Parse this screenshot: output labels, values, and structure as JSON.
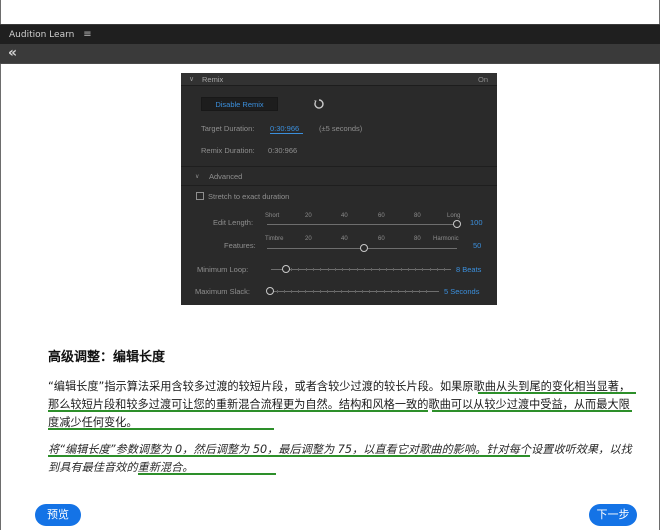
{
  "app": {
    "title": "Audition Learn",
    "menu_glyph": "≡",
    "back_glyph": "«"
  },
  "remix": {
    "header": "Remix",
    "header_state": "On",
    "disable_button": "Disable Remix",
    "target_duration_label": "Target Duration:",
    "target_duration_value": "0:30:966",
    "target_duration_tolerance": "(±5 seconds)",
    "remix_duration_label": "Remix Duration:",
    "remix_duration_value": "0:30:966",
    "advanced_label": "Advanced",
    "stretch_label": "Stretch to exact duration",
    "edit_length": {
      "label": "Edit Length:",
      "left": "Short",
      "right": "Long",
      "ticks": [
        "20",
        "40",
        "60",
        "80"
      ],
      "value": "100",
      "level": 100
    },
    "features": {
      "label": "Features:",
      "left": "Timbre",
      "right": "Harmonic",
      "ticks": [
        "20",
        "40",
        "60",
        "80"
      ],
      "value": "50",
      "level": 50
    },
    "minimum_loop": {
      "label": "Minimum Loop:",
      "value": "8 Beats",
      "level": 5
    },
    "maximum_slack": {
      "label": "Maximum Slack:",
      "value": "5 Seconds",
      "level": 0
    }
  },
  "content": {
    "heading": "高级调整：编辑长度",
    "paragraph1": "“编辑长度”指示算法采用含较多过渡的较短片段，或者含较少过渡的较长片段。如果原歌曲从头到尾的变化相当显著，那么较短片段和较多过渡可让您的重新混合流程更为自然。结构和风格一致的歌曲可以从较少过渡中受益，从而最大限度减少任何变化。",
    "paragraph2": "将“编辑长度”参数调整为 0，然后调整为 50，最后调整为 75，以直看它对歌曲的影响。针对每个设置收听效果，以找到具有最佳音效的重新混合。"
  },
  "buttons": {
    "prev": "预览",
    "next": "下一步"
  },
  "colors": {
    "accent": "#1473e6",
    "highlight_underline": "#2d8f2a",
    "remix_blue": "#3b8fdc"
  }
}
